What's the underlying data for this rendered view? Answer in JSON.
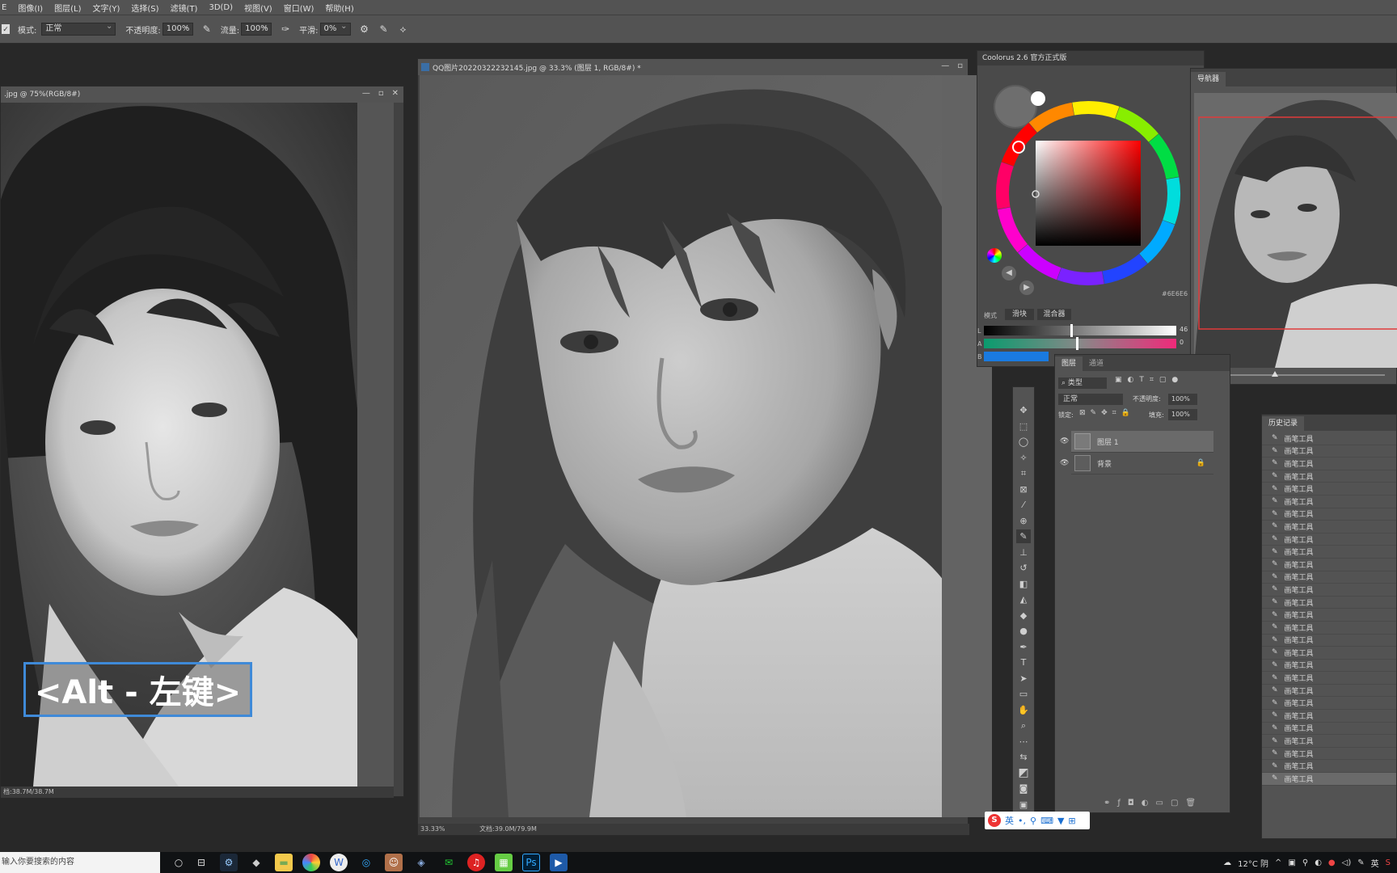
{
  "menu": [
    "E",
    "图像(I)",
    "图层(L)",
    "文字(Y)",
    "选择(S)",
    "滤镜(T)",
    "3D(D)",
    "视图(V)",
    "窗口(W)",
    "帮助(H)"
  ],
  "options": {
    "mode_label": "模式:",
    "mode_value": "正常",
    "opacity_label": "不透明度:",
    "opacity_value": "100%",
    "flow_label": "流量:",
    "flow_value": "100%",
    "smooth_label": "平滑:",
    "smooth_value": "0%"
  },
  "ref_window": {
    "title": ".jpg @ 75%(RGB/8#)",
    "status": "档:38.7M/38.7M",
    "caption": "<Alt - 左键>"
  },
  "main_window": {
    "title": "QQ图片20220322232145.jpg @ 33.3% (图层 1, RGB/8#) *",
    "zoom": "33.33%",
    "doc_info": "文档:39.0M/79.9M"
  },
  "coolorus": {
    "title": "Coolorus 2.6 官方正式版",
    "hex": "#6E6E6",
    "mode_label": "模式",
    "tab_slider": "滑块",
    "tab_mixer": "混合器",
    "slider_value_1": "46",
    "slider_value_2": "0",
    "slider_label_1": "L",
    "slider_label_2": "A",
    "slider_label_3": "B"
  },
  "navigator": {
    "title": "导航器"
  },
  "layers_panel": {
    "tab_layers": "图层",
    "tab_channels": "通道",
    "filter_label": "类型",
    "blend_mode": "正常",
    "opacity_label": "不透明度:",
    "opacity_value": "100%",
    "lock_label": "锁定:",
    "fill_label": "填充:",
    "fill_value": "100%",
    "layers": [
      {
        "name": "图层 1"
      },
      {
        "name": "背景"
      }
    ]
  },
  "history": {
    "title": "历史记录",
    "items": [
      "画笔工具",
      "画笔工具",
      "画笔工具",
      "画笔工具",
      "画笔工具",
      "画笔工具",
      "画笔工具",
      "画笔工具",
      "画笔工具",
      "画笔工具",
      "画笔工具",
      "画笔工具",
      "画笔工具",
      "画笔工具",
      "画笔工具",
      "画笔工具",
      "画笔工具",
      "画笔工具",
      "画笔工具",
      "画笔工具",
      "画笔工具",
      "画笔工具",
      "画笔工具",
      "画笔工具",
      "画笔工具",
      "画笔工具",
      "画笔工具",
      "画笔工具"
    ]
  },
  "ime": {
    "lang": "英"
  },
  "taskbar": {
    "search_placeholder": "输入你要搜索的内容",
    "weather": "12°C 阴",
    "lang": "英"
  },
  "colors": {
    "accent": "#3d84c6",
    "hue_ring": "rainbow",
    "caption_border": "#3f8ad8"
  }
}
